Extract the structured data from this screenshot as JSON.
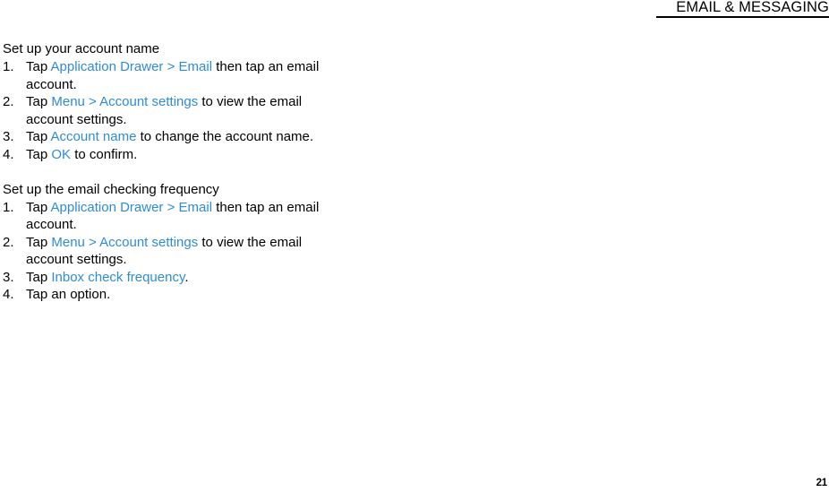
{
  "header": {
    "title": "EMAIL & MESSAGING"
  },
  "link_color": "#2f8bd7",
  "sections": [
    {
      "heading": "Set up your account name",
      "steps": [
        {
          "num": "1.",
          "pre": "Tap ",
          "link": "Application Drawer > Email",
          "post": " then tap an email",
          "wrap": "account."
        },
        {
          "num": "2.",
          "pre": "Tap ",
          "link": "Menu > Account settings",
          "post": " to view the email",
          "wrap": "account settings."
        },
        {
          "num": "3.",
          "pre": "Tap ",
          "link": "Account name",
          "post": " to change the account name.",
          "wrap": ""
        },
        {
          "num": "4.",
          "pre": "Tap ",
          "link": "OK",
          "post": " to confirm.",
          "wrap": ""
        }
      ]
    },
    {
      "heading": "Set up the email checking frequency",
      "steps": [
        {
          "num": "1.",
          "pre": "Tap ",
          "link": "Application Drawer > Email",
          "post": " then tap an email",
          "wrap": "account."
        },
        {
          "num": "2.",
          "pre": "Tap ",
          "link": "Menu > Account settings",
          "post": " to view the email",
          "wrap": "account settings."
        },
        {
          "num": "3.",
          "pre": "Tap ",
          "link": "Inbox check frequency",
          "post": ".",
          "wrap": ""
        },
        {
          "num": "4.",
          "pre": "Tap an option.",
          "link": "",
          "post": "",
          "wrap": ""
        }
      ]
    }
  ],
  "folio": {
    "page_number": "21"
  }
}
